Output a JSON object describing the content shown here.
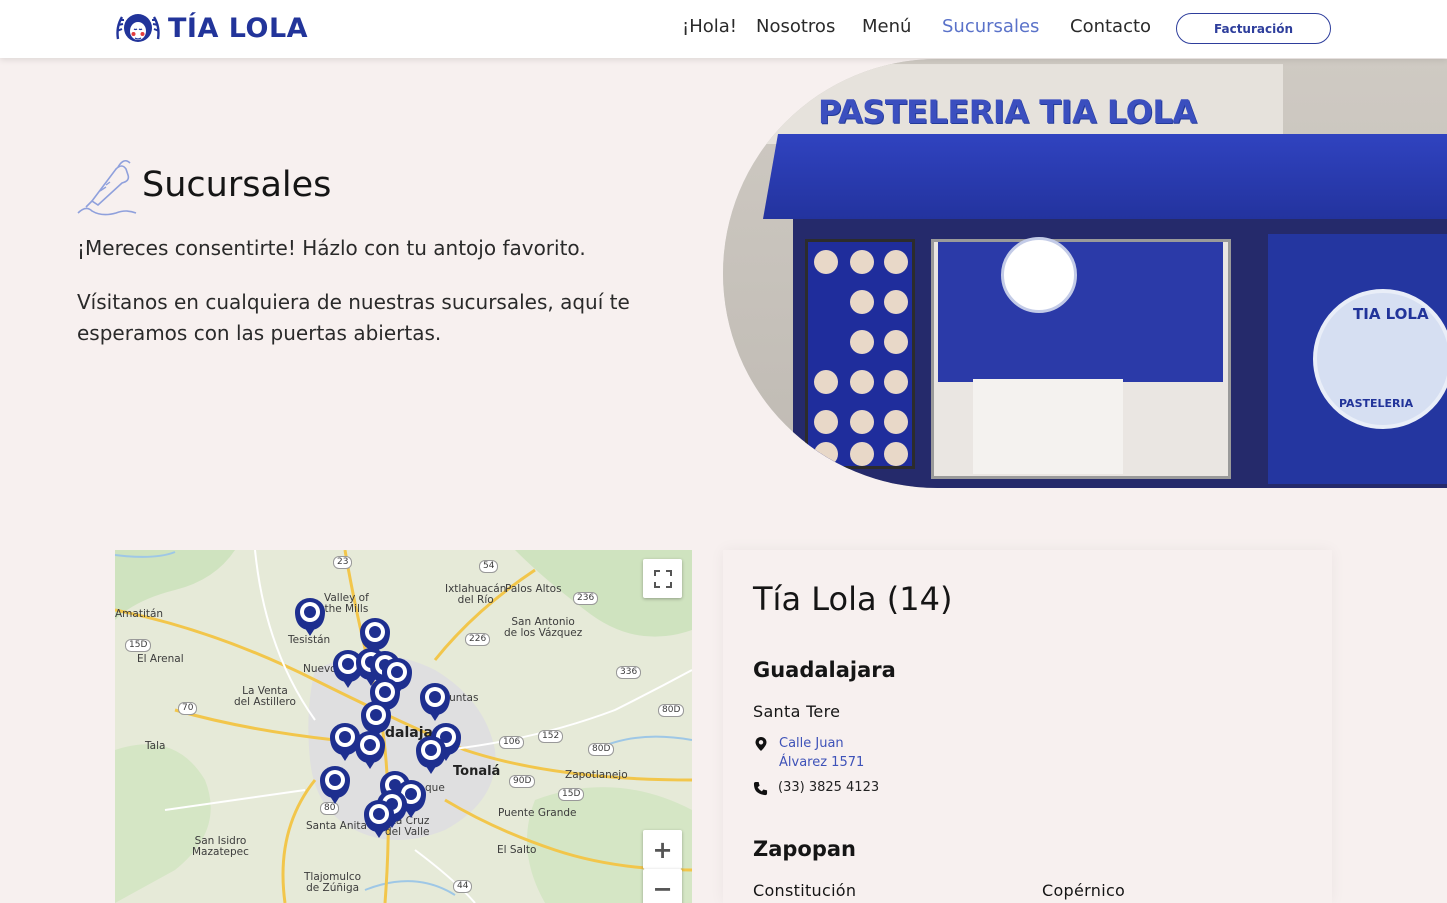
{
  "brand": {
    "name": "TÍA LOLA",
    "color": "#22349a"
  },
  "nav": {
    "items": [
      {
        "label": "¡Hola!"
      },
      {
        "label": "Nosotros"
      },
      {
        "label": "Menú"
      },
      {
        "label": "Sucursales",
        "active": true
      },
      {
        "label": "Contacto"
      }
    ],
    "cta_label": "Facturación"
  },
  "hero": {
    "title": "Sucursales",
    "paragraph1": "¡Mereces consentirte! Házlo con tu antojo favorito.",
    "paragraph2": "Vísitanos en cualquiera de nuestras sucursales, aquí te esperamos con las puertas abiertas.",
    "icon": "piping-bag-icon"
  },
  "store_image": {
    "sign_text": "PASTELERIA TIA LOLA",
    "badge_top": "TIA LOLA",
    "badge_bottom": "PASTELERIA"
  },
  "map": {
    "places": {
      "amatitan": "Amatitán",
      "el_arenal": "El Arenal",
      "tesistan": "Tesistán",
      "valley": "Valley of\nthe Mills",
      "ixtlahuacan": "Ixtlahuacán\ndel Río",
      "palos_altos": "Palos Altos",
      "san_antonio": "San Antonio\nde los Vázquez",
      "la_venta": "La Venta\ndel Astillero",
      "nuevo": "Nuevo",
      "juntas": "Juntas",
      "tala": "Tala",
      "guadalajara": "dalaja",
      "tonala": "Tonalá",
      "zapotlanejo": "Zapotlanejo",
      "puente_grande": "Puente Grande",
      "santa_anita": "Santa Anita",
      "santa_cruz": "nta Cruz\ndel Valle",
      "tlaque": "que",
      "el_salto": "El Salto",
      "san_isidro": "San Isidro\nMazatepec",
      "tlajomulco": "Tlajomulco\nde Zúñiga"
    },
    "shields": [
      "23",
      "54",
      "236",
      "226",
      "15D",
      "70",
      "336",
      "80D",
      "106",
      "152",
      "80D",
      "90D",
      "15D",
      "80",
      "44"
    ],
    "zoom_in": "+",
    "zoom_out": "−",
    "fullscreen_icon": "fullscreen-icon",
    "marker_color": "#1e2f8f"
  },
  "branches": {
    "title": "Tía Lola (14)",
    "cities": [
      {
        "name": "Guadalajara",
        "stores": [
          {
            "name": "Santa Tere",
            "address_line1": "Calle Juan",
            "address_line2": "Álvarez 1571",
            "phone": "(33) 3825 4123"
          }
        ]
      },
      {
        "name": "Zapopan",
        "stores": [
          {
            "name": "Constitución"
          },
          {
            "name": "Copérnico"
          }
        ]
      }
    ]
  }
}
